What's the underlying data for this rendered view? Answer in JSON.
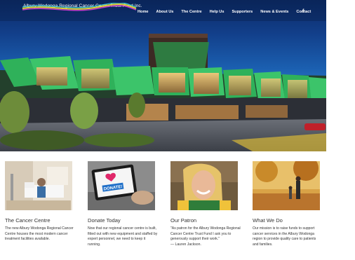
{
  "site": {
    "title": "Albury Wodonga Regional Cancer Centre Trust Fund Inc."
  },
  "nav": {
    "items": [
      {
        "label": "Home"
      },
      {
        "label": "About Us"
      },
      {
        "label": "The Centre"
      },
      {
        "label": "Help Us"
      },
      {
        "label": "Supporters"
      },
      {
        "label": "News & Events"
      },
      {
        "label": "Contact"
      }
    ],
    "facebook": "f"
  },
  "hero": {
    "building_sign": "Albury Wodonga Regional Cancer Centre",
    "icon": "building-photo"
  },
  "cards": [
    {
      "title": "The Cancer Centre",
      "text": "The new Albury Wodonga Regional Cancer Centre houses the most modern cancer treatment facilities available.",
      "image": "hospital-room-photo"
    },
    {
      "title": "Donate Today",
      "text": "Now that our regional cancer centre is built, fitted out with new equipment and staffed by expert personnel, we need to keep it running.",
      "image": "tablet-donate-photo",
      "screen_label": "DONATE!"
    },
    {
      "title": "Our Patron",
      "text": "\"As patron for the Albury Wodonga Regional Cancer Centre Trust Fund I ask you to generously support their work.\"",
      "attribution": "— Lauren Jackson.",
      "image": "patron-portrait-photo"
    },
    {
      "title": "What We Do",
      "text": "Our mission is to raise funds to support cancer services in the Albury Wodonga region to provide quality care to patients and families.",
      "image": "autumn-walk-photo"
    }
  ]
}
